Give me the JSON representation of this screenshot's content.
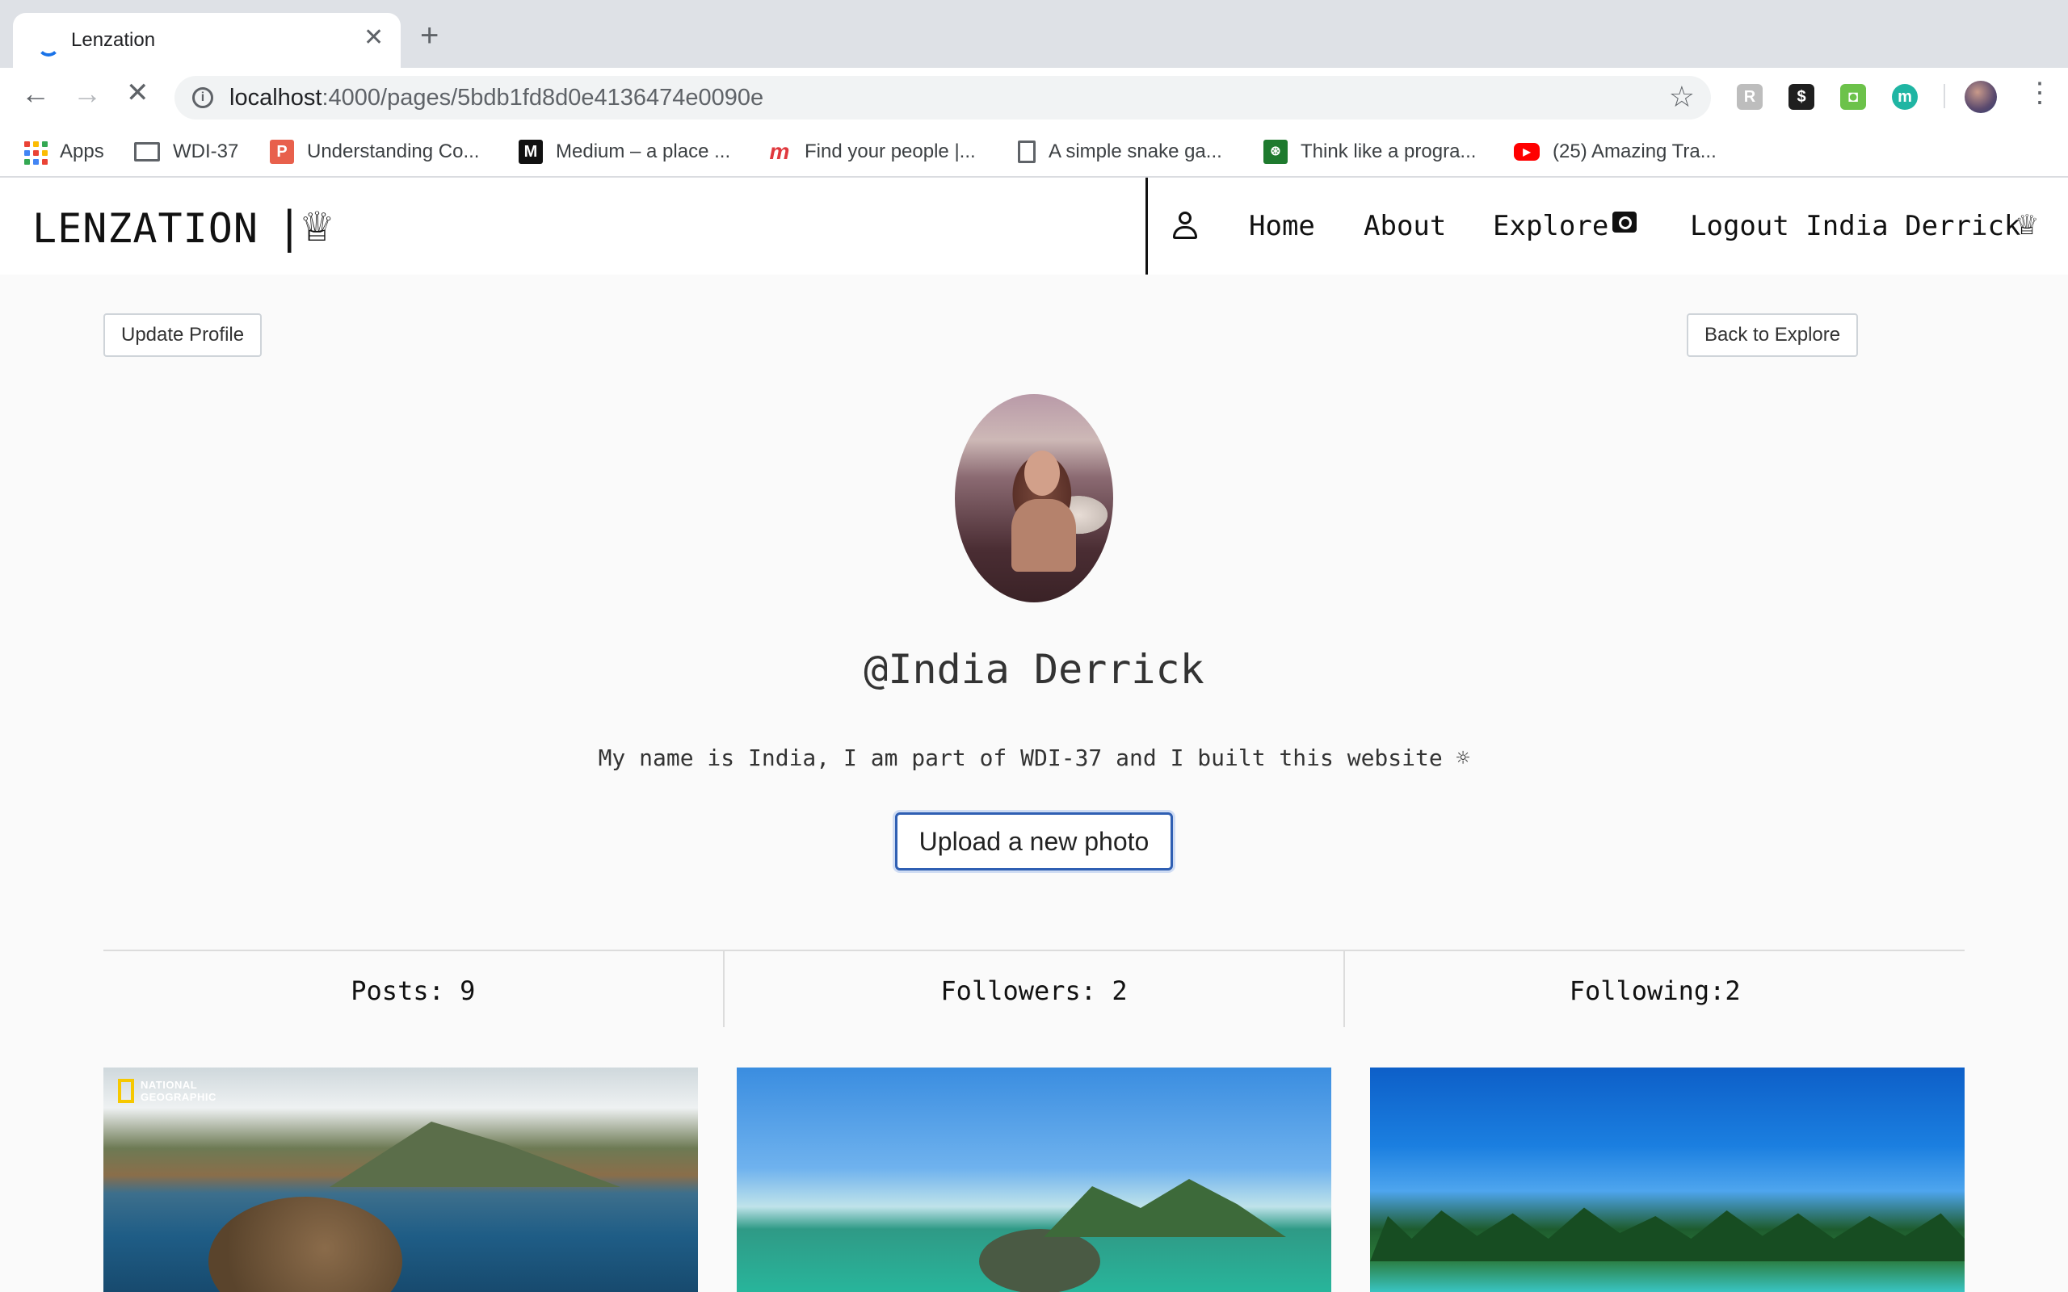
{
  "browser": {
    "tab_title": "Lenzation",
    "url_host": "localhost",
    "url_path": ":4000/pages/5bdb1fd8d0e4136474e0090e",
    "bookmarks": [
      {
        "label": "Apps",
        "icon": "apps-grid-icon"
      },
      {
        "label": "WDI-37",
        "icon": "folder-icon"
      },
      {
        "label": "Understanding Co...",
        "icon": "p-icon"
      },
      {
        "label": "Medium – a place ...",
        "icon": "medium-icon"
      },
      {
        "label": "Find your people |...",
        "icon": "meetup-icon"
      },
      {
        "label": "A simple snake ga...",
        "icon": "page-icon"
      },
      {
        "label": "Think like a progra...",
        "icon": "book-icon"
      },
      {
        "label": "(25) Amazing Tra...",
        "icon": "youtube-icon"
      }
    ]
  },
  "header": {
    "brand": "LENZATION",
    "brand_sep": "|",
    "nav": {
      "home": "Home",
      "about": "About",
      "explore": "Explore",
      "logout": "Logout India Derrick"
    }
  },
  "actions": {
    "update_profile": "Update Profile",
    "back_to_explore": "Back to Explore",
    "upload_photo": "Upload a new photo"
  },
  "profile": {
    "username": "@India Derrick",
    "bio": "My name is India, I am part of WDI-37 and I built this website ☼"
  },
  "stats": {
    "posts": "Posts: 9",
    "followers": "Followers: 2",
    "following": "Following:2"
  },
  "gallery": {
    "watermark_line1": "NATIONAL",
    "watermark_line2": "GEOGRAPHIC"
  },
  "colors": {
    "upload_border": "#2f5fb3",
    "tabstrip": "#dee1e6",
    "page_bg": "#fafafa"
  }
}
